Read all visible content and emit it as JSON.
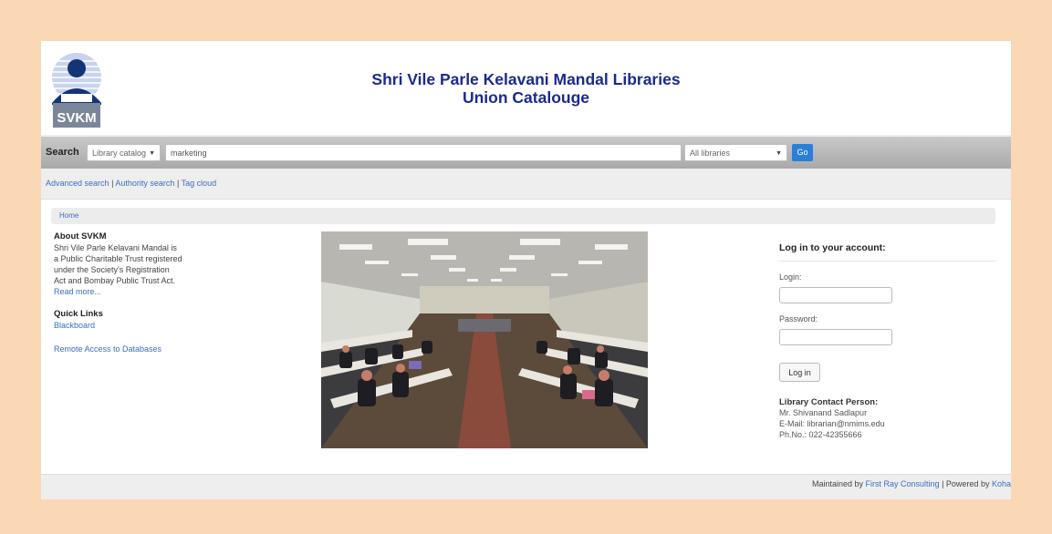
{
  "header": {
    "logo_text": "SVKM",
    "title_line1": "Shri Vile Parle Kelavani Mandal Libraries",
    "title_line2": "Union Catalouge"
  },
  "search": {
    "label": "Search",
    "scope_selected": "Library catalog",
    "query_value": "marketing",
    "library_selected": "All libraries",
    "go_label": "Go"
  },
  "search_links": [
    {
      "label": "Advanced search"
    },
    {
      "label": "Authority search"
    },
    {
      "label": "Tag cloud"
    }
  ],
  "breadcrumb": {
    "home": "Home"
  },
  "about": {
    "heading": "About SVKM",
    "lines": [
      "Shri Vile Parle Kelavani Mandal is",
      "a Public Charitable Trust registered",
      "under the Society's Registration",
      "Act and Bombay Public Trust Act."
    ],
    "read_more": "Read more..."
  },
  "quick_links": {
    "heading": "Quick Links",
    "items": [
      {
        "label": "Blackboard"
      },
      {
        "label": "Remote Access to Databases"
      }
    ]
  },
  "login": {
    "title": "Log in to your account:",
    "login_label": "Login:",
    "password_label": "Password:",
    "button_label": "Log in"
  },
  "contact": {
    "heading": "Library Contact Person:",
    "name": "Mr. Shivanand Sadlapur",
    "email": "E-Mail: librarian@nmims.edu",
    "phone": "Ph.No.: 022-42355666"
  },
  "footer": {
    "maintained_prefix": "Maintained by",
    "maintainer": "First Ray Consulting",
    "powered_prefix": "| Powered by",
    "powered_link": "Koha"
  },
  "colors": {
    "page_background": "#fad7b5",
    "title_blue": "#1a2a8e",
    "link_blue": "#3c6ec0",
    "go_button": "#2b7fd6"
  }
}
